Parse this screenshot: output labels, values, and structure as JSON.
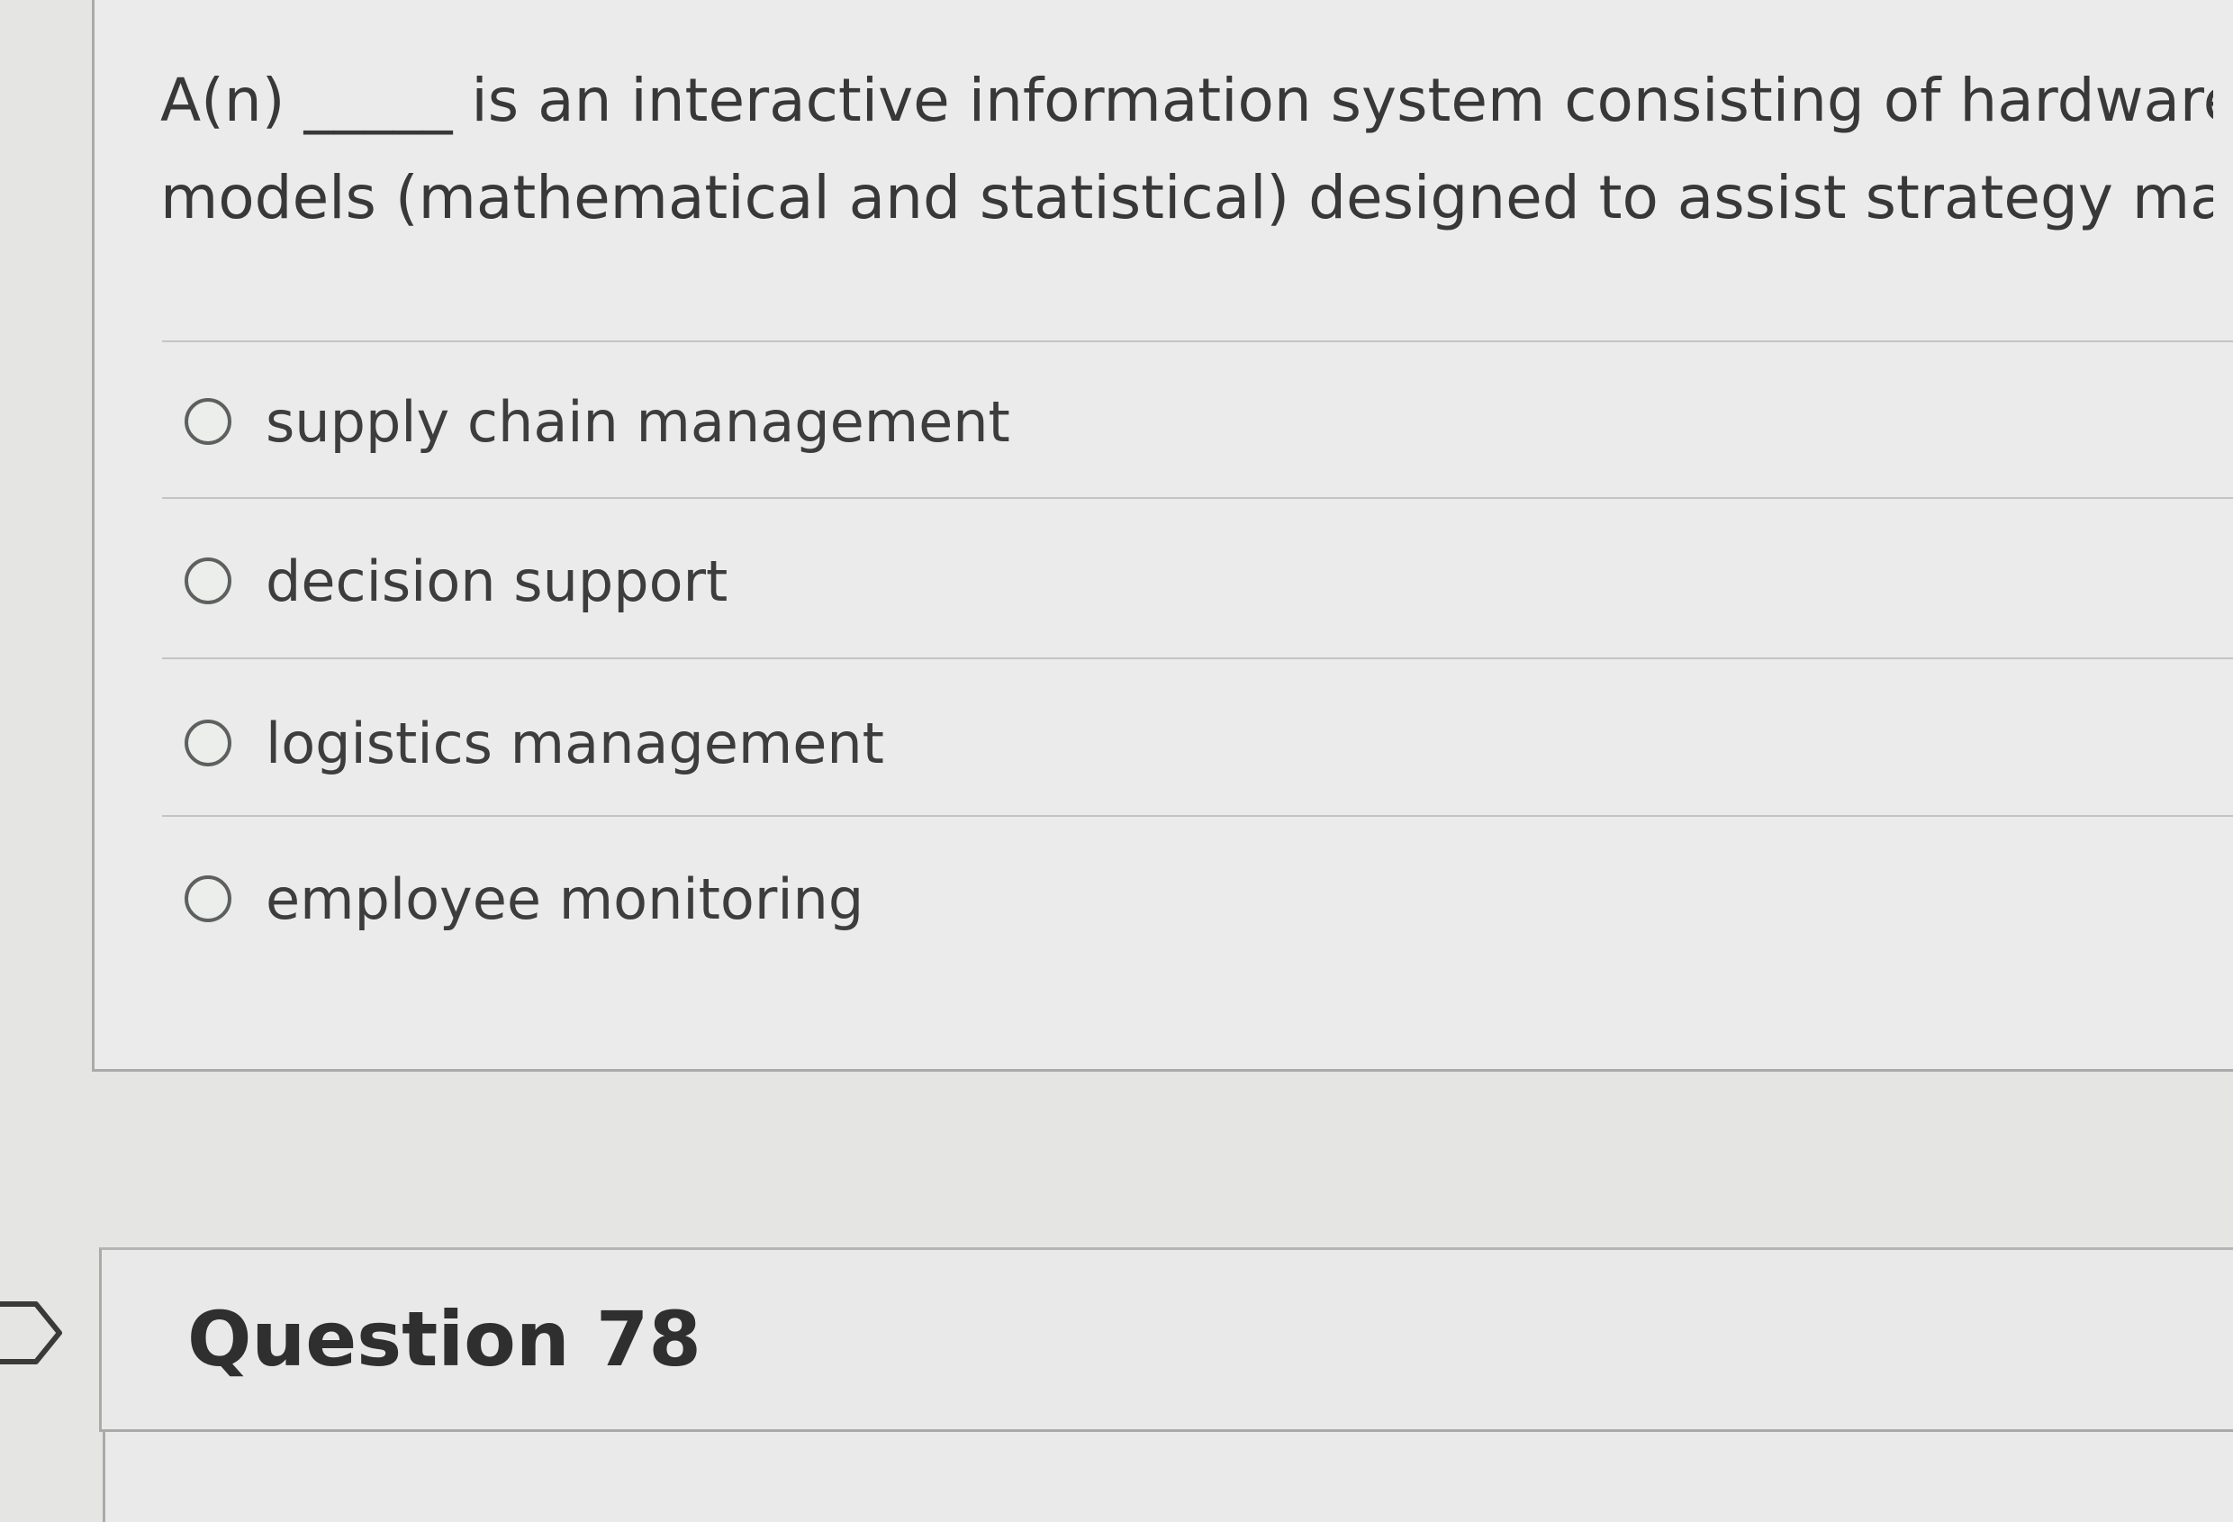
{
  "question": {
    "line1": "A(n) _____ is an interactive information system consisting of hardware, softw",
    "line2": "models (mathematical and statistical) designed to assist strategy makers in a",
    "options": [
      {
        "label": "supply chain management",
        "selected": false
      },
      {
        "label": "decision support",
        "selected": false
      },
      {
        "label": "logistics management",
        "selected": false
      },
      {
        "label": "employee monitoring",
        "selected": false
      }
    ]
  },
  "next_question": {
    "title": "Question 78",
    "flag_icon": "flag-outline-icon"
  }
}
